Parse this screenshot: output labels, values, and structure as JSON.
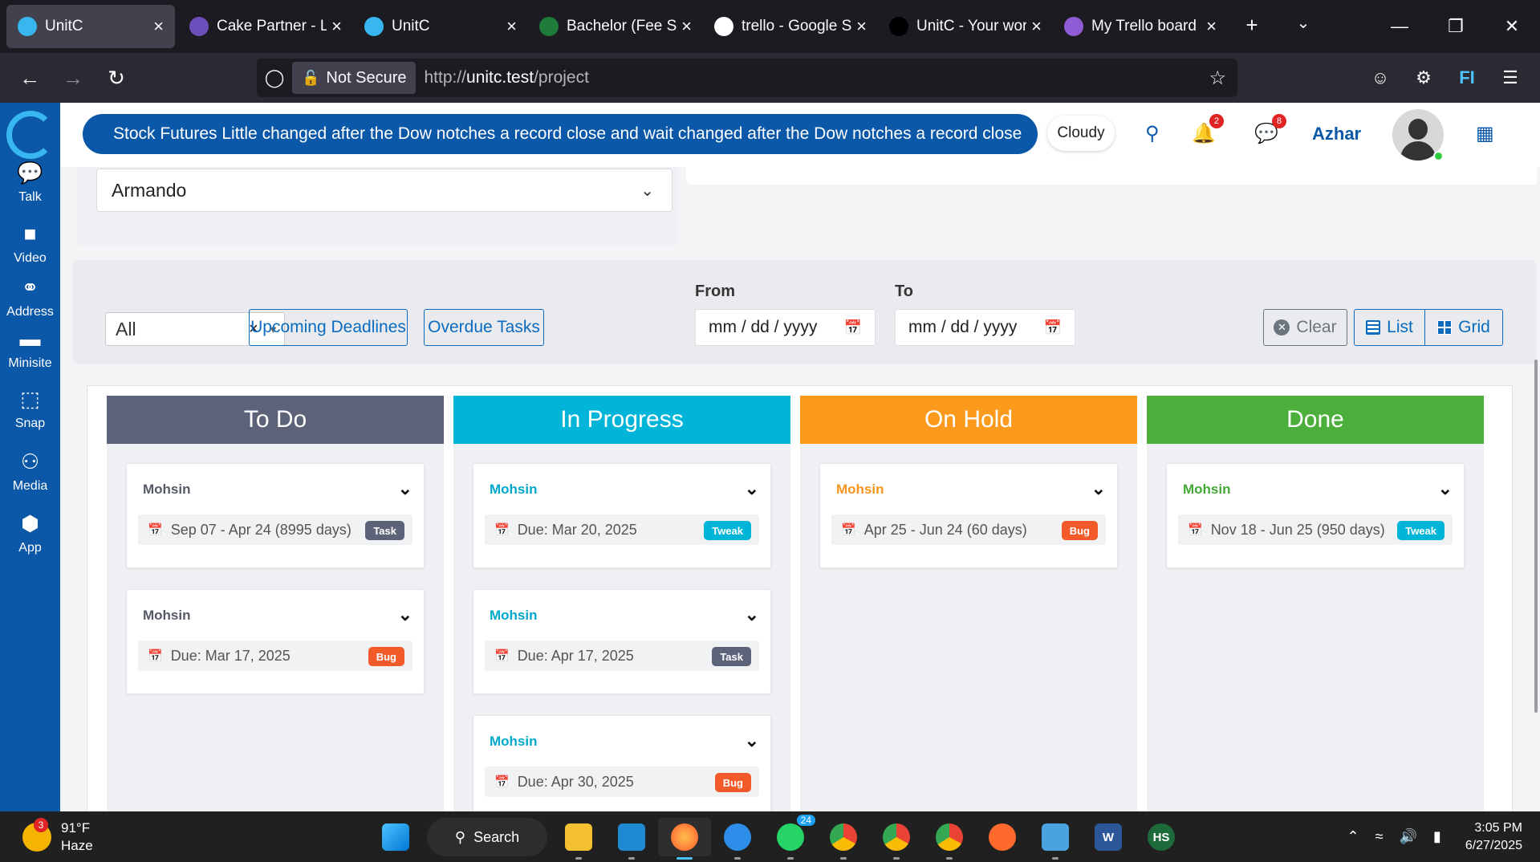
{
  "browser": {
    "tabs": [
      {
        "title": "UnitC",
        "active": true,
        "favicon": "unitc-logo"
      },
      {
        "title": "Cake Partner - Lo",
        "active": false,
        "favicon": "cake-icon"
      },
      {
        "title": "UnitC",
        "active": false,
        "favicon": "unitc-logo"
      },
      {
        "title": "Bachelor (Fee Str",
        "active": false,
        "favicon": "globe-icon"
      },
      {
        "title": "trello - Google S",
        "active": false,
        "favicon": "google-icon"
      },
      {
        "title": "UnitC - Your wor",
        "active": false,
        "favicon": "unitc-dark-icon"
      },
      {
        "title": "My Trello board |",
        "active": false,
        "favicon": "trello-icon"
      }
    ],
    "security_label": "Not Secure",
    "url_prefix": "http://",
    "url_host": "unitc.test",
    "url_path": "/project"
  },
  "sidebar": {
    "items": [
      {
        "label": "Talk",
        "icon": "chat-icon"
      },
      {
        "label": "Video",
        "icon": "video-icon"
      },
      {
        "label": "Address",
        "icon": "link-icon"
      },
      {
        "label": "Minisite",
        "icon": "monitor-icon"
      },
      {
        "label": "Snap",
        "icon": "crop-icon"
      },
      {
        "label": "Media",
        "icon": "users-icon"
      },
      {
        "label": "App",
        "icon": "cube-icon"
      }
    ]
  },
  "header": {
    "ticker": "Stock Futures Little changed after the Dow notches a record close and wait changed after the Dow notches a record close",
    "weather": "Cloudy",
    "notifications_count": "2",
    "messages_count": "8",
    "username": "Azhar"
  },
  "project_select": {
    "value": "Armando"
  },
  "filters": {
    "type_value": "All",
    "upcoming_label": "Upcoming Deadlines",
    "overdue_label": "Overdue Tasks",
    "from_label": "From",
    "to_label": "To",
    "date_placeholder": "mm / dd / yyyy",
    "clear_label": "Clear",
    "list_label": "List",
    "grid_label": "Grid"
  },
  "board": {
    "columns": [
      {
        "title": "To Do",
        "color": "#5c6378",
        "name_color": "#555b66",
        "cards": [
          {
            "assignee": "Mohsin",
            "date": "Sep 07 - Apr 24 (8995 days)",
            "tag": "Task"
          },
          {
            "assignee": "Mohsin",
            "date": "Due: Mar 17, 2025",
            "tag": "Bug"
          }
        ]
      },
      {
        "title": "In Progress",
        "color": "#00b5d8",
        "name_color": "#00a9cc",
        "cards": [
          {
            "assignee": "Mohsin",
            "date": "Due: Mar 20, 2025",
            "tag": "Tweak"
          },
          {
            "assignee": "Mohsin",
            "date": "Due: Apr 17, 2025",
            "tag": "Task"
          },
          {
            "assignee": "Mohsin",
            "date": "Due: Apr 30, 2025",
            "tag": "Bug"
          }
        ]
      },
      {
        "title": "On Hold",
        "color": "#fc9a1e",
        "name_color": "#f7941d",
        "cards": [
          {
            "assignee": "Mohsin",
            "date": "Apr 25 - Jun 24 (60 days)",
            "tag": "Bug"
          }
        ]
      },
      {
        "title": "Done",
        "color": "#4caf3b",
        "name_color": "#44a836",
        "cards": [
          {
            "assignee": "Mohsin",
            "date": "Nov 18 - Jun 25 (950 days)",
            "tag": "Tweak"
          }
        ]
      }
    ],
    "tag_colors": {
      "Task": "#5c6378",
      "Bug": "#f25a29",
      "Tweak": "#00b5d8"
    }
  },
  "taskbar": {
    "weather_temp": "91°F",
    "weather_desc": "Haze",
    "weather_badge": "3",
    "search_label": "Search",
    "whatsapp_badge": "24",
    "time": "3:05 PM",
    "date": "6/27/2025"
  }
}
